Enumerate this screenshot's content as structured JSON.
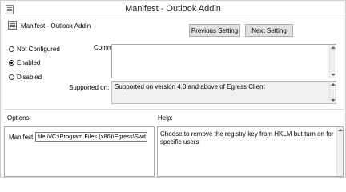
{
  "window": {
    "title": "Manifest - Outlook Addin"
  },
  "header": {
    "title": "Manifest - Outlook Addin",
    "prev_label": "Previous Setting",
    "next_label": "Next Setting"
  },
  "state": {
    "options": [
      {
        "label": "Not Configured",
        "checked": false
      },
      {
        "label": "Enabled",
        "checked": true
      },
      {
        "label": "Disabled",
        "checked": false
      }
    ]
  },
  "comment": {
    "label": "Comment:",
    "value": ""
  },
  "supported": {
    "label": "Supported on:",
    "value": "Supported on version 4.0 and above of Egress Client"
  },
  "options_section": {
    "label": "Options:",
    "manifest_label": "Manifest",
    "manifest_value": "file:///C:\\Program Files (x86)\\Egress\\Swit"
  },
  "help_section": {
    "label": "Help:",
    "text": "Choose to remove the registry key from HKLM but turn on for specific users"
  }
}
